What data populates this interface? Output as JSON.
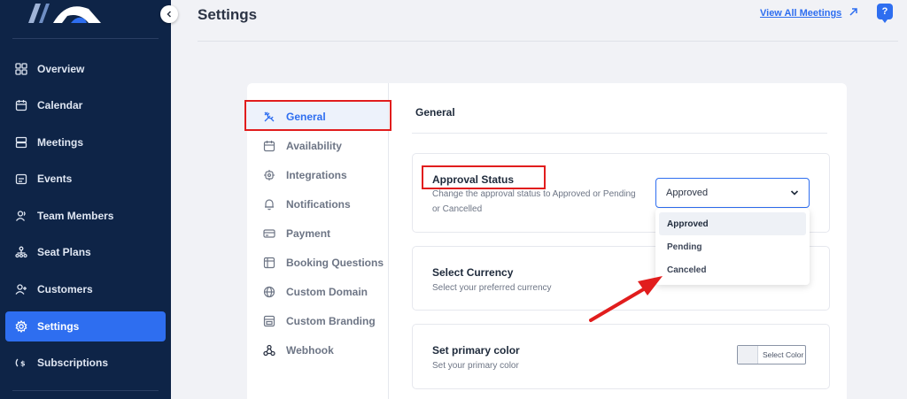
{
  "sidebar": {
    "items": [
      {
        "label": "Overview",
        "icon": "grid-icon",
        "active": false
      },
      {
        "label": "Calendar",
        "icon": "calendar-icon",
        "active": false
      },
      {
        "label": "Meetings",
        "icon": "server-icon",
        "active": false
      },
      {
        "label": "Events",
        "icon": "event-icon",
        "active": false
      },
      {
        "label": "Team Members",
        "icon": "users-icon",
        "active": false
      },
      {
        "label": "Seat Plans",
        "icon": "seat-plan-icon",
        "active": false
      },
      {
        "label": "Customers",
        "icon": "user-plus-icon",
        "active": false
      },
      {
        "label": "Settings",
        "icon": "gear-icon",
        "active": true
      },
      {
        "label": "Subscriptions",
        "icon": "dollar-icon",
        "active": false
      }
    ],
    "colors": {
      "bg": "#0e2447",
      "active": "#2e6ef0"
    }
  },
  "header": {
    "title": "Settings",
    "link_label": "View All Meetings",
    "help_label": "?"
  },
  "settings_nav": {
    "items": [
      {
        "label": "General",
        "icon": "tools-icon",
        "active": true
      },
      {
        "label": "Availability",
        "icon": "calendar-icon"
      },
      {
        "label": "Integrations",
        "icon": "chip-icon"
      },
      {
        "label": "Notifications",
        "icon": "bell-icon"
      },
      {
        "label": "Payment",
        "icon": "card-icon"
      },
      {
        "label": "Booking Questions",
        "icon": "form-icon"
      },
      {
        "label": "Custom Domain",
        "icon": "globe-icon"
      },
      {
        "label": "Custom Branding",
        "icon": "branding-icon"
      },
      {
        "label": "Webhook",
        "icon": "webhook-icon"
      }
    ]
  },
  "content": {
    "title": "General",
    "approval": {
      "title": "Approval Status",
      "description": "Change the approval status to Approved or Pending or Cancelled",
      "selected": "Approved",
      "options": [
        "Approved",
        "Pending",
        "Canceled"
      ]
    },
    "currency": {
      "title": "Select Currency",
      "description": "Select your preferred currency"
    },
    "primary_color": {
      "title": "Set primary color",
      "description": "Set your primary color",
      "button_label": "Select Color"
    }
  },
  "annotation_color": "#e11d1d"
}
